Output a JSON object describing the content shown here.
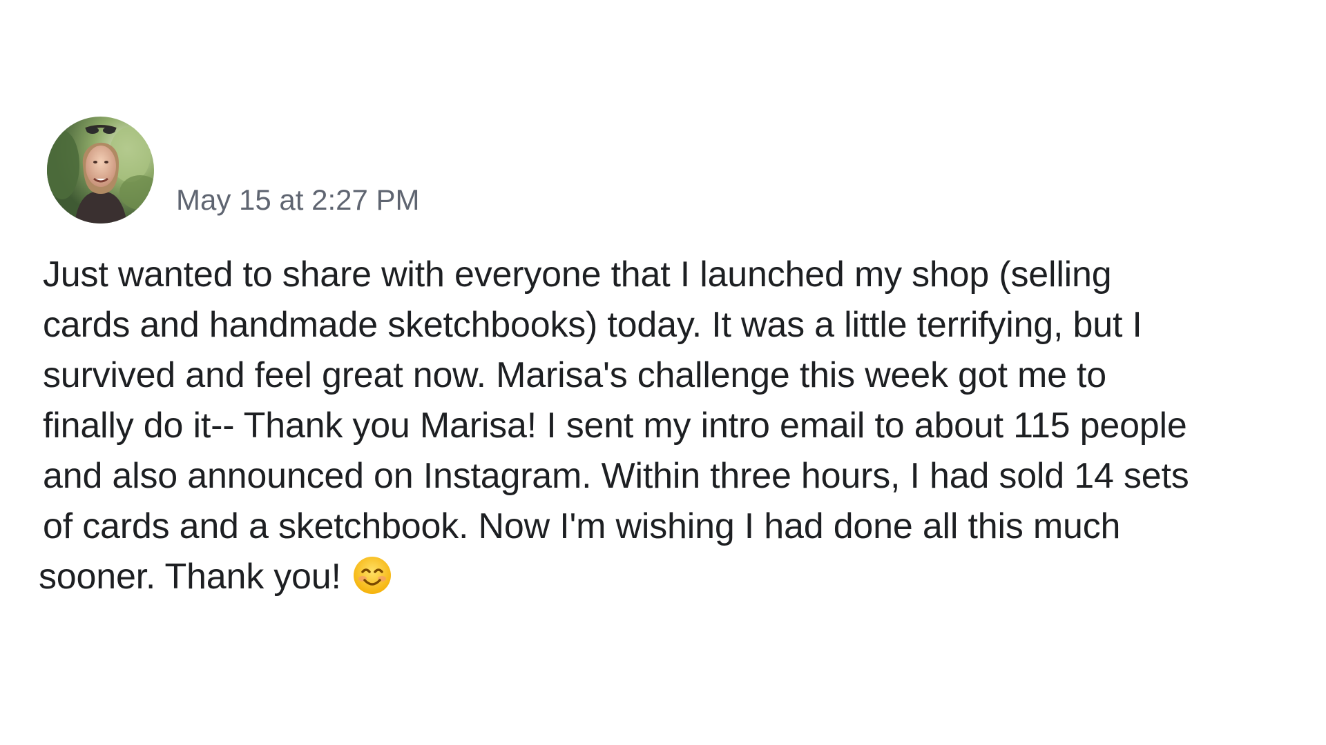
{
  "post": {
    "author_avatar": "avatar-photo",
    "timestamp": "May 15 at 2:27 PM",
    "body_lines": [
      "Just wanted to share with everyone that I launched my shop (selling",
      "cards and handmade sketchbooks) today. It was a little terrifying, but I",
      "survived and feel great now. Marisa's challenge this week got me to",
      "finally do it-- Thank you Marisa! I sent my intro email to about 115 people",
      "and also announced on Instagram. Within three hours, I had sold 14 sets",
      "of cards and a sketchbook.  Now I'm wishing I had done all this much",
      "sooner. Thank you!"
    ],
    "emoji": "smiling-face-icon"
  }
}
